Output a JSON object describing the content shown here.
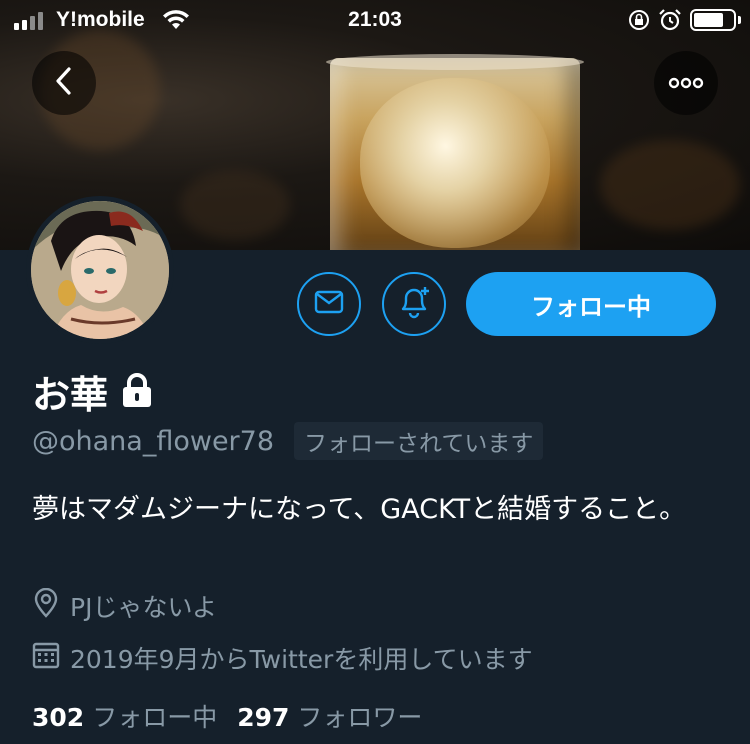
{
  "status_bar": {
    "carrier": "Y!mobile",
    "time": "21:03",
    "signal_icon": "cellular-signal-icon",
    "wifi_icon": "wifi-icon",
    "rotation_lock_icon": "rotation-lock-icon",
    "alarm_icon": "alarm-icon",
    "battery_icon": "battery-icon",
    "battery_level": 0.75
  },
  "nav": {
    "back_icon": "chevron-left-icon",
    "more_icon": "more-horizontal-icon"
  },
  "header": {
    "image": "whisky-glass-banner"
  },
  "actions": {
    "dm_icon": "envelope-icon",
    "notifications_icon": "bell-plus-icon",
    "follow_label": "フォロー中"
  },
  "profile": {
    "display_name": "お華",
    "protected_icon": "lock-icon",
    "handle": "@ohana_flower78",
    "follows_you": "フォローされています",
    "bio": "夢はマダムジーナになって、GACKTと結婚すること。",
    "location_icon": "location-pin-icon",
    "location": "PJじゃないよ",
    "joined_icon": "calendar-icon",
    "joined": "2019年9月からTwitterを利用しています"
  },
  "stats": {
    "following_count": "302",
    "following_label": "フォロー中",
    "followers_count": "297",
    "followers_label": "フォロワー"
  },
  "colors": {
    "background": "#15202b",
    "accent": "#1da1f2",
    "secondary_text": "#8899a6"
  }
}
